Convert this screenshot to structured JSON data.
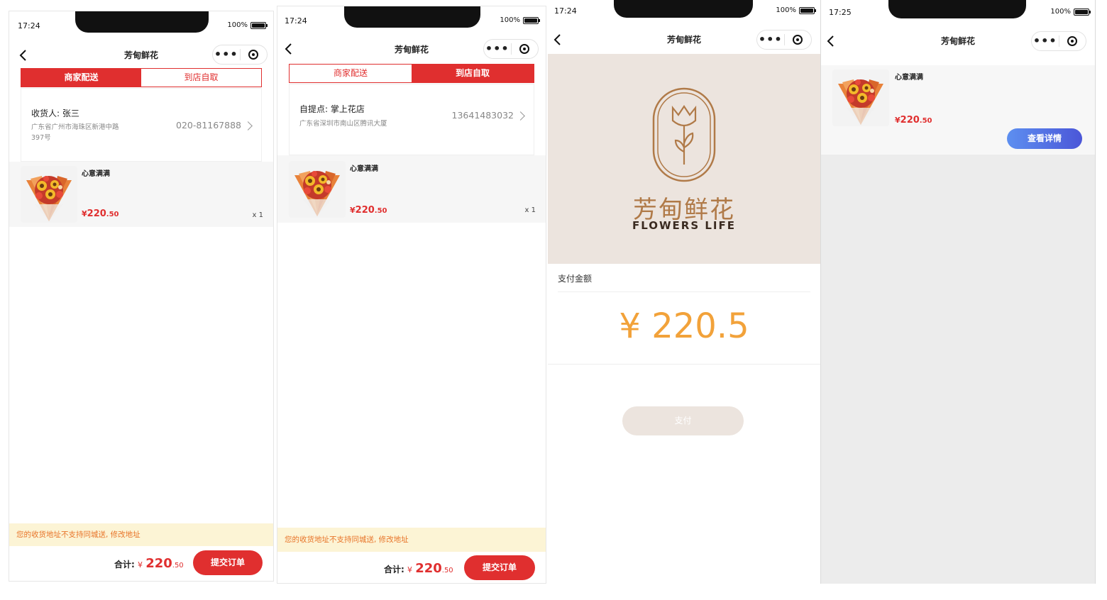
{
  "app": {
    "title": "芳甸鲜花"
  },
  "screen1": {
    "time": "17:24",
    "battery": "100%",
    "tabs": [
      "商家配送",
      "到店自取"
    ],
    "receiver": "收货人: 张三",
    "address_line1": "广东省广州市海珠区新港中路",
    "address_line2": "397号",
    "phone": "020-81167888",
    "item": {
      "name": "心意满满",
      "currency": "¥",
      "price_int": "220",
      "price_dec": ".50",
      "qty": "x 1"
    },
    "notice": "您的收货地址不支持同城送, 修改地址",
    "total_label": "合计:",
    "total_currency": "¥",
    "total_int": "220",
    "total_dec": ".50",
    "submit": "提交订单"
  },
  "screen2": {
    "time": "17:24",
    "battery": "100%",
    "tabs": [
      "商家配送",
      "到店自取"
    ],
    "pickup": "自提点: 掌上花店",
    "address": "广东省深圳市南山区腾讯大厦",
    "phone": "13641483032",
    "item": {
      "name": "心意满满",
      "currency": "¥",
      "price_int": "220",
      "price_dec": ".50",
      "qty": "x 1"
    },
    "notice": "您的收货地址不支持同城送, 修改地址",
    "total_label": "合计:",
    "total_currency": "¥",
    "total_int": "220",
    "total_dec": ".50",
    "submit": "提交订单"
  },
  "screen3": {
    "time": "17:24",
    "battery": "100%",
    "brand_cn": "芳甸鲜花",
    "brand_en": "FLOWERS LIFE",
    "pay_label": "支付金额",
    "amount": "¥ 220.5",
    "pay_button": "支付"
  },
  "screen4": {
    "time": "17:25",
    "battery": "100%",
    "item": {
      "name": "心意满满",
      "currency": "¥",
      "price_int": "220",
      "price_dec": ".50"
    },
    "detail_button": "查看详情"
  },
  "colors": {
    "accent": "#e02f2f",
    "amount": "#f2a23a",
    "brand": "#b07a48",
    "brand_bg": "#ece4de",
    "notice_bg": "#fcf4d5",
    "notice_text": "#e8752a"
  }
}
